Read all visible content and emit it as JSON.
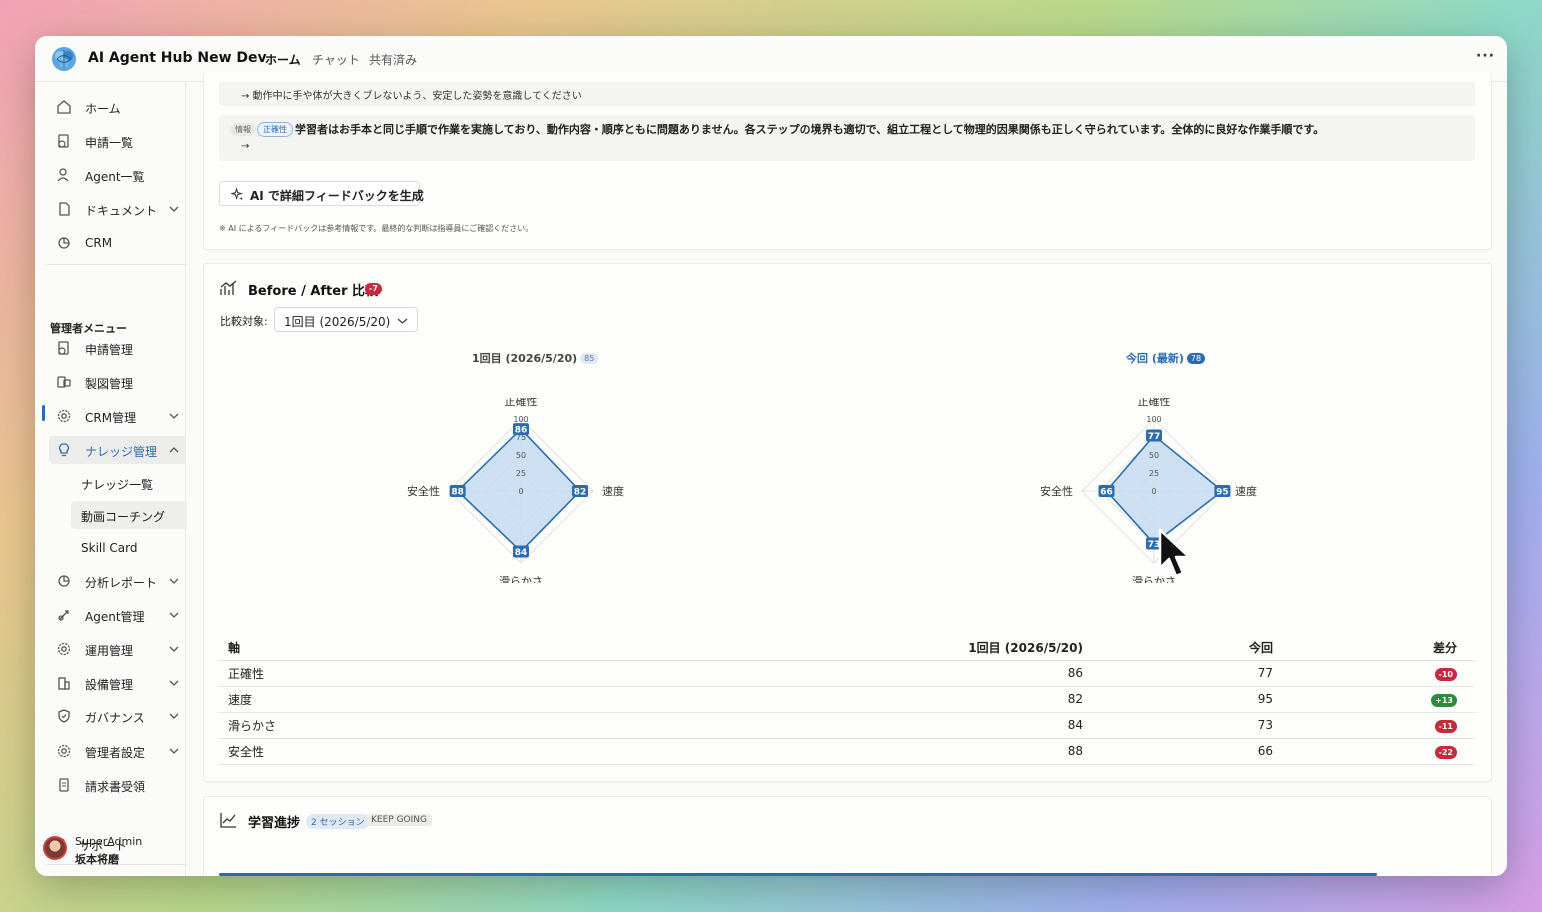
{
  "app": {
    "title": "AI Agent Hub New Dev",
    "more_icon": "more-horizontal-icon"
  },
  "tabs": [
    {
      "label": "ホーム",
      "active": true
    },
    {
      "label": "チャット",
      "active": false
    },
    {
      "label": "共有済み",
      "active": false
    }
  ],
  "sidebar": {
    "items": [
      {
        "label": "ホーム",
        "icon": "home-icon"
      },
      {
        "label": "申請一覧",
        "icon": "request-list-icon"
      },
      {
        "label": "Agent一覧",
        "icon": "agent-icon"
      },
      {
        "label": "ドキュメント",
        "icon": "document-icon",
        "expandable": true
      },
      {
        "label": "CRM",
        "icon": "crm-icon"
      }
    ],
    "admin_section_label": "管理者メニュー",
    "admin_items": [
      {
        "label": "申請管理",
        "icon": "request-manage-icon"
      },
      {
        "label": "製図管理",
        "icon": "drafting-icon"
      },
      {
        "label": "CRM管理",
        "icon": "gear-icon",
        "expandable": true
      },
      {
        "label": "ナレッジ管理",
        "icon": "lightbulb-icon",
        "expandable": true,
        "expanded": true,
        "active": true
      }
    ],
    "knowledge_sub": [
      {
        "label": "ナレッジ一覧"
      },
      {
        "label": "動画コーチング",
        "selected": true
      },
      {
        "label": "Skill Card"
      }
    ],
    "more_items": [
      {
        "label": "分析レポート",
        "icon": "analytics-icon"
      },
      {
        "label": "Agent管理",
        "icon": "rocket-icon"
      },
      {
        "label": "運用管理",
        "icon": "gear-icon"
      },
      {
        "label": "設備管理",
        "icon": "building-icon"
      },
      {
        "label": "ガバナンス",
        "icon": "shield-icon"
      },
      {
        "label": "管理者設定",
        "icon": "gear-icon"
      },
      {
        "label": "請求書受領",
        "icon": "invoice-icon"
      }
    ],
    "support_label": "サポート",
    "user": {
      "role": "SuperAdmin",
      "name": "坂本将磨"
    }
  },
  "feedback": {
    "line1": "→ 動作中に手や体が大きくブレないよう、安定した姿勢を意識してください",
    "info_tag": "情報",
    "category_tag": "正確性",
    "info_text": "学習者はお手本と同じ手順で作業を実施しており、動作内容・順序ともに問題ありません。各ステップの境界も適切で、組立工程として物理的因果関係も正しく守られています。全体的に良好な作業手順です。",
    "info_arrow": "→",
    "generate_button": "AI で詳細フィードバックを生成",
    "note": "※ AI によるフィードバックは参考情報です。最終的な判断は指導員にご確認ください。"
  },
  "comparison": {
    "title": "Before / After 比較",
    "badge": "-7",
    "target_label": "比較対象:",
    "target_value": "1回目 (2026/5/20)",
    "left_title": "1回目 (2026/5/20)",
    "left_score": "85",
    "right_title": "今回 (最新)",
    "right_score": "78",
    "table_headers": {
      "axis": "軸",
      "before": "1回目 (2026/5/20)",
      "now": "今回",
      "diff": "差分"
    },
    "rows": [
      {
        "axis": "正確性",
        "before": "86",
        "now": "77",
        "diff": "-10"
      },
      {
        "axis": "速度",
        "before": "82",
        "now": "95",
        "diff": "+13"
      },
      {
        "axis": "滑らかさ",
        "before": "84",
        "now": "73",
        "diff": "-11"
      },
      {
        "axis": "安全性",
        "before": "88",
        "now": "66",
        "diff": "-22"
      }
    ]
  },
  "chart_data": [
    {
      "type": "radar",
      "title": "1回目 (2026/5/20)",
      "axes": [
        "正確性",
        "速度",
        "滑らかさ",
        "安全性"
      ],
      "values": [
        86,
        82,
        84,
        88
      ],
      "rlim": [
        0,
        100
      ],
      "ticks": [
        "0",
        "25",
        "50",
        "75",
        "100"
      ]
    },
    {
      "type": "radar",
      "title": "今回 (最新)",
      "axes": [
        "正確性",
        "速度",
        "滑らかさ",
        "安全性"
      ],
      "values": [
        77,
        95,
        73,
        66
      ],
      "rlim": [
        0,
        100
      ],
      "ticks": [
        "0",
        "25",
        "50",
        "75",
        "100"
      ]
    }
  ],
  "progress": {
    "title": "学習進捗",
    "sessions_tag": "2 セッション",
    "status_tag": "KEEP GOING"
  },
  "colors": {
    "accent": "#2b6cb0",
    "radar_fill": "#c5dcf2",
    "negative": "#c62b3b",
    "positive": "#2e8b3d"
  }
}
